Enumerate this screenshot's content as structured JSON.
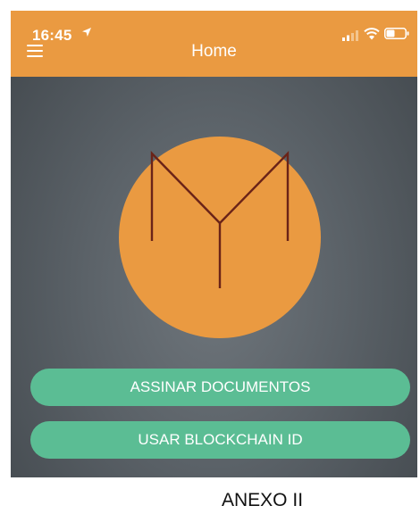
{
  "status_bar": {
    "time": "16:45",
    "icons": [
      "location-arrow-icon",
      "cellular-signal-icon",
      "wifi-icon",
      "battery-icon"
    ]
  },
  "header": {
    "title": "Home",
    "menu_icon": "hamburger-menu-icon"
  },
  "logo": {
    "icon": "m-monogram-logo",
    "circle_color": "#ea9a41",
    "stroke_color": "#6a2318"
  },
  "buttons": {
    "sign_documents": "ASSINAR DOCUMENTOS",
    "use_blockchain_id": "USAR BLOCKCHAIN ID"
  },
  "caption": "ANEXO II",
  "colors": {
    "accent": "#ea9a41",
    "button": "#5bbd94",
    "background": "#5b6268"
  }
}
